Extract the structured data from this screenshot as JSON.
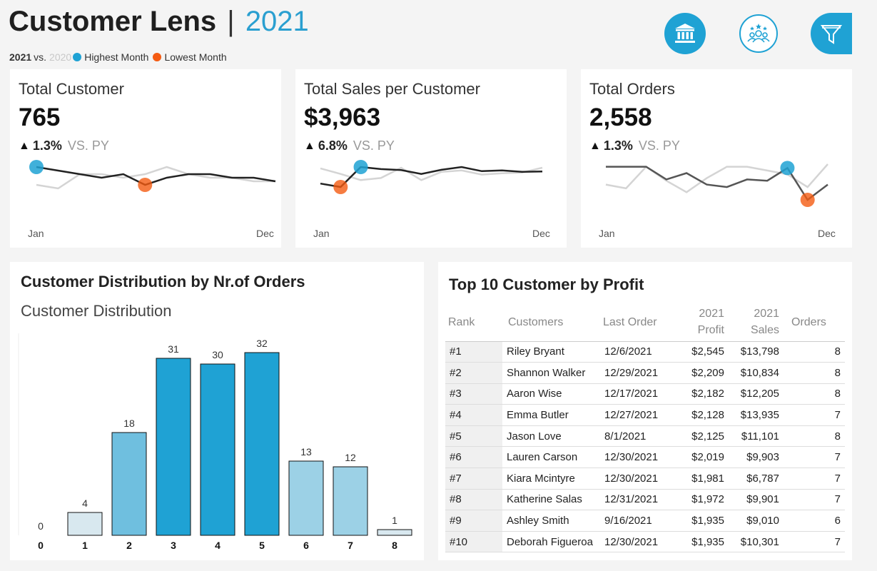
{
  "header": {
    "title": "Customer Lens",
    "separator": "|",
    "year": "2021",
    "legend": {
      "current": "2021",
      "vs": "vs.",
      "previous": "2020",
      "highest": "Highest Month",
      "lowest": "Lowest Month"
    },
    "icons": [
      "bank-icon",
      "customers-icon",
      "filter-icon"
    ]
  },
  "colors": {
    "accent": "#1fa2d4",
    "highest": "#1fa2d4",
    "lowest": "#f45b12",
    "prior_year_line": "#d4d4d4",
    "current_year_line": "#222222"
  },
  "kpis": [
    {
      "title": "Total Customer",
      "value": "765",
      "change": "1.3%",
      "vs_label": "VS. PY",
      "axis_start": "Jan",
      "axis_end": "Dec",
      "current": [
        72,
        71,
        70,
        69,
        70,
        67,
        69,
        70,
        70,
        69,
        69,
        68
      ],
      "previous": [
        67,
        66,
        70,
        70,
        69,
        70,
        72,
        70,
        69,
        69,
        68,
        68
      ],
      "highest_index": 0,
      "lowest_index": 5
    },
    {
      "title": "Total Sales per Customer",
      "value": "$3,963",
      "change": "6.8%",
      "vs_label": "VS. PY",
      "axis_start": "Jan",
      "axis_end": "Dec",
      "current": [
        3750,
        3700,
        3990,
        3960,
        3945,
        3890,
        3950,
        3990,
        3930,
        3940,
        3920,
        3925
      ],
      "previous": [
        3970,
        3890,
        3800,
        3830,
        3980,
        3800,
        3920,
        3940,
        3880,
        3900,
        3910,
        3980
      ],
      "highest_index": 2,
      "lowest_index": 1
    },
    {
      "title": "Total Orders",
      "value": "2,558",
      "change": "1.3%",
      "vs_label": "VS. PY",
      "axis_start": "Jan",
      "axis_end": "Dec",
      "current": [
        232,
        232,
        232,
        212,
        222,
        204,
        200,
        212,
        210,
        230,
        180,
        204
      ],
      "previous": [
        204,
        198,
        232,
        210,
        192,
        214,
        232,
        232,
        226,
        220,
        200,
        236
      ],
      "highest_index": 9,
      "lowest_index": 10
    }
  ],
  "distribution": {
    "title": "Customer Distribution by Nr.of Orders",
    "subtitle": "Customer Distribution"
  },
  "chart_data": {
    "type": "bar",
    "title": "Customer Distribution",
    "categories": [
      "0",
      "1",
      "2",
      "3",
      "4",
      "5",
      "6",
      "7",
      "8"
    ],
    "values": [
      0,
      4,
      18,
      31,
      30,
      32,
      13,
      12,
      1
    ],
    "ylim": [
      0,
      36
    ]
  },
  "top10": {
    "title": "Top 10 Customer by Profit",
    "headers": {
      "rank": "Rank",
      "customers": "Customers",
      "last_order": "Last Order",
      "profit_1": "2021",
      "profit_2": "Profit",
      "sales_1": "2021",
      "sales_2": "Sales",
      "orders": "Orders"
    },
    "rows": [
      {
        "rank": "#1",
        "name": "Riley Bryant",
        "last_order": "12/6/2021",
        "profit": "$2,545",
        "sales": "$13,798",
        "orders": "8"
      },
      {
        "rank": "#2",
        "name": "Shannon Walker",
        "last_order": "12/29/2021",
        "profit": "$2,209",
        "sales": "$10,834",
        "orders": "8"
      },
      {
        "rank": "#3",
        "name": "Aaron Wise",
        "last_order": "12/17/2021",
        "profit": "$2,182",
        "sales": "$12,205",
        "orders": "8"
      },
      {
        "rank": "#4",
        "name": "Emma Butler",
        "last_order": "12/27/2021",
        "profit": "$2,128",
        "sales": "$13,935",
        "orders": "7"
      },
      {
        "rank": "#5",
        "name": "Jason Love",
        "last_order": "8/1/2021",
        "profit": "$2,125",
        "sales": "$11,101",
        "orders": "8"
      },
      {
        "rank": "#6",
        "name": "Lauren Carson",
        "last_order": "12/30/2021",
        "profit": "$2,019",
        "sales": "$9,903",
        "orders": "7"
      },
      {
        "rank": "#7",
        "name": "Kiara Mcintyre",
        "last_order": "12/30/2021",
        "profit": "$1,981",
        "sales": "$6,787",
        "orders": "7"
      },
      {
        "rank": "#8",
        "name": "Katherine Salas",
        "last_order": "12/31/2021",
        "profit": "$1,972",
        "sales": "$9,901",
        "orders": "7"
      },
      {
        "rank": "#9",
        "name": "Ashley Smith",
        "last_order": "9/16/2021",
        "profit": "$1,935",
        "sales": "$9,010",
        "orders": "6"
      },
      {
        "rank": "#10",
        "name": "Deborah Figueroa",
        "last_order": "12/30/2021",
        "profit": "$1,935",
        "sales": "$10,301",
        "orders": "7"
      }
    ]
  }
}
